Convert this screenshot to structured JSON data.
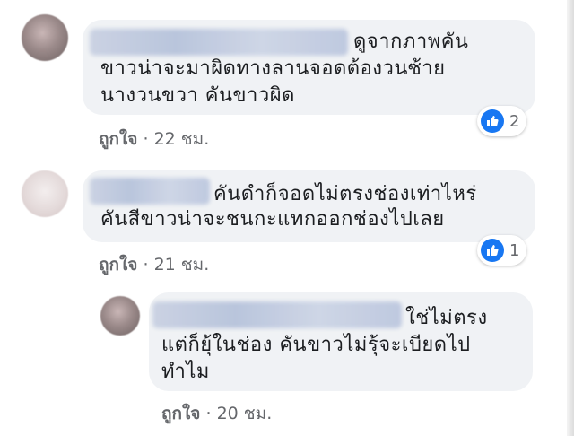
{
  "comments": [
    {
      "text_lines": [
        "ดูจากภาพคัน",
        "ขาวน่าจะมาผิดทางลานจอดต้องวนซ้าย",
        "นางวนขวา คันขาวผิด"
      ],
      "like_label": "ถูกใจ",
      "separator": "·",
      "time": "22 ชม.",
      "reaction_count": "2",
      "reaction_icon": "like-thumb-icon"
    },
    {
      "text_lines": [
        "คันดำก็จอดไม่ตรงช่องเท่าไหร่",
        "คันสีขาวน่าจะชนกะแทกออกช่องไปเลย"
      ],
      "like_label": "ถูกใจ",
      "separator": "·",
      "time": "21 ชม.",
      "reaction_count": "1",
      "reaction_icon": "like-thumb-icon"
    },
    {
      "text_lines": [
        "ใช่ไม่ตรง",
        "แต่ก็ยุ้ในช่อง คันขาวไม่รุ้จะเบียดไป",
        "ทำไม"
      ],
      "like_label": "ถูกใจ",
      "separator": "·",
      "time": "20 ชม."
    }
  ],
  "colors": {
    "bubble": "#f0f2f5",
    "meta_text": "#65676b",
    "like_blue": "#1877f2"
  }
}
